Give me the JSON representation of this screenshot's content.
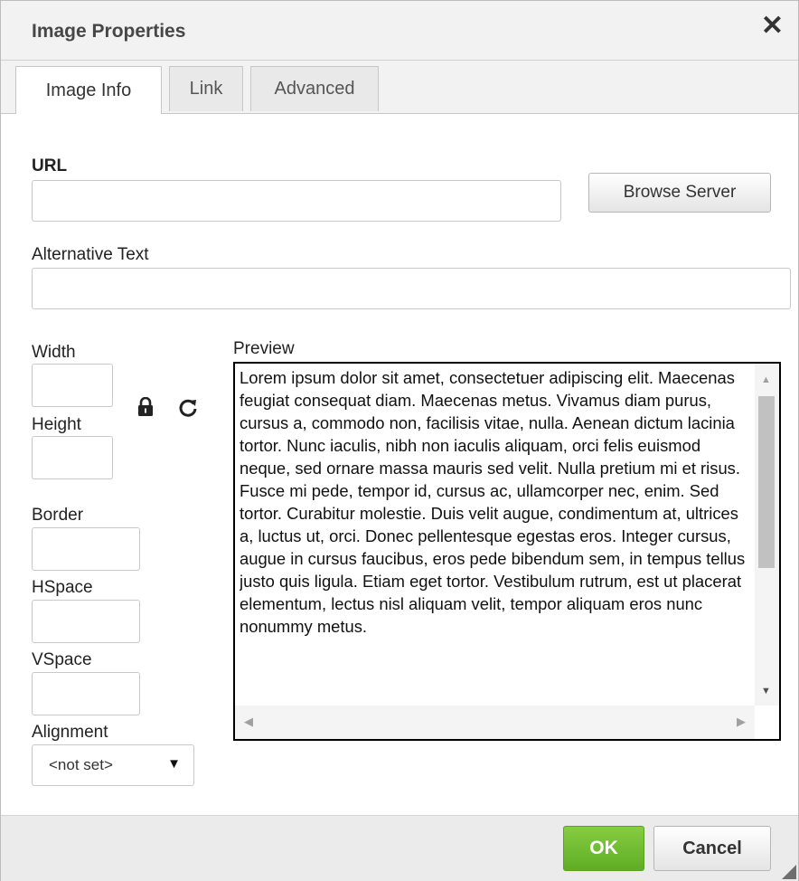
{
  "dialog": {
    "title": "Image Properties",
    "close_symbol": "✕"
  },
  "tabs": [
    {
      "label": "Image Info",
      "active": true
    },
    {
      "label": "Link",
      "active": false
    },
    {
      "label": "Advanced",
      "active": false
    }
  ],
  "url": {
    "label": "URL",
    "value": "",
    "browse_label": "Browse Server"
  },
  "alt_text": {
    "label": "Alternative Text",
    "value": ""
  },
  "dimensions": {
    "width_label": "Width",
    "width_value": "",
    "height_label": "Height",
    "height_value": "",
    "lock_icon": "lock-icon",
    "reset_icon": "reset-size-icon"
  },
  "border": {
    "label": "Border",
    "value": ""
  },
  "hspace": {
    "label": "HSpace",
    "value": ""
  },
  "vspace": {
    "label": "VSpace",
    "value": ""
  },
  "alignment": {
    "label": "Alignment",
    "value": "<not set>",
    "caret": "▼"
  },
  "preview": {
    "label": "Preview",
    "text": "Lorem ipsum dolor sit amet, consectetuer adipiscing elit. Maecenas feugiat consequat diam. Maecenas metus. Vivamus diam purus, cursus a, commodo non, facilisis vitae, nulla. Aenean dictum lacinia tortor. Nunc iaculis, nibh non iaculis aliquam, orci felis euismod neque, sed ornare massa mauris sed velit. Nulla pretium mi et risus. Fusce mi pede, tempor id, cursus ac, ullamcorper nec, enim. Sed tortor. Curabitur molestie. Duis velit augue, condimentum at, ultrices a, luctus ut, orci. Donec pellentesque egestas eros. Integer cursus, augue in cursus faucibus, eros pede bibendum sem, in tempus tellus justo quis ligula. Etiam eget tortor. Vestibulum rutrum, est ut placerat elementum, lectus nisl aliquam velit, tempor aliquam eros nunc nonummy metus."
  },
  "footer": {
    "ok_label": "OK",
    "cancel_label": "Cancel"
  },
  "colors": {
    "ok_green": "#6cb92e",
    "titlebar": "#f2f2f2",
    "footer": "#ebebeb"
  }
}
